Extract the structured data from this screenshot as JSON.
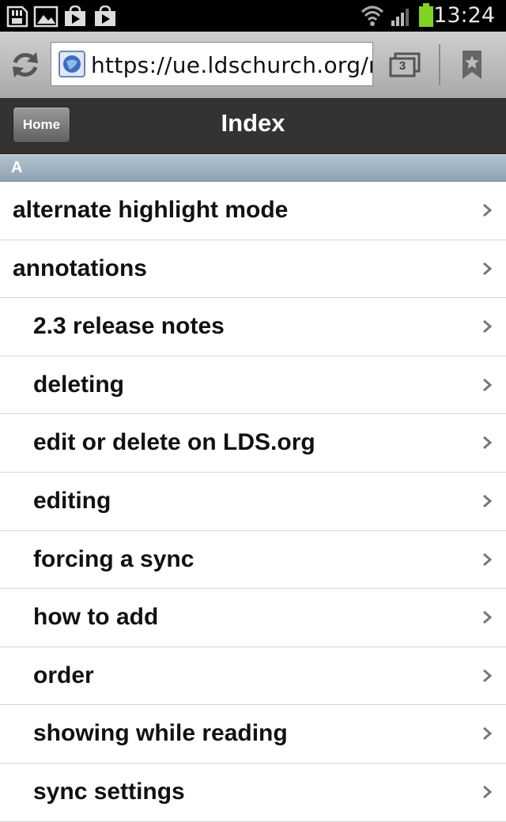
{
  "status_bar": {
    "time": "13:24",
    "icons": [
      "sd-card-icon",
      "image-icon",
      "play-store-icon",
      "shopping-bag-icon",
      "wifi-icon",
      "signal-icon",
      "battery-icon"
    ]
  },
  "browser": {
    "url": "https://ue.ldschurch.org/m",
    "tab_count": "3",
    "icons": [
      "refresh-icon",
      "site-favicon",
      "tabs-icon",
      "bookmark-icon"
    ]
  },
  "header": {
    "home_label": "Home",
    "title": "Index"
  },
  "section": {
    "letter": "A"
  },
  "items": [
    {
      "label": "alternate highlight mode"
    },
    {
      "label": "annotations"
    },
    {
      "label": "2.3 release notes"
    },
    {
      "label": "deleting"
    },
    {
      "label": "edit or delete on LDS.org"
    },
    {
      "label": "editing"
    },
    {
      "label": "forcing a sync"
    },
    {
      "label": "how to add"
    },
    {
      "label": "order"
    },
    {
      "label": "showing while reading"
    },
    {
      "label": "sync settings"
    }
  ],
  "colors": {
    "status_bar": "#000000",
    "title_bar": "#333333",
    "section_header": "#9fb2c1",
    "battery": "#7fd321"
  }
}
